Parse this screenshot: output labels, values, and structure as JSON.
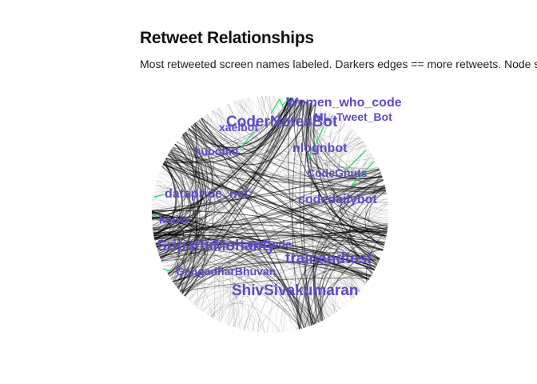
{
  "title": "Retweet Relationships",
  "subtitle": "Most retweeted screen names labeled. Darkers edges == more retweets. Node s",
  "colors": {
    "label": "#5b4bc4",
    "highlight_edge": "#22e06a",
    "edge": "#000000"
  },
  "nodes": [
    {
      "id": "women_who_code",
      "label": "Women_who_code",
      "size": "medium"
    },
    {
      "id": "ml_tweet_bot",
      "label": "ML_Tweet_Bot",
      "size": "small"
    },
    {
      "id": "codernotesbot",
      "label": "CoderNotesBot",
      "size": "large"
    },
    {
      "id": "xaelbot",
      "label": "xaelbot",
      "size": "small"
    },
    {
      "id": "hubofml",
      "label": "hubofml",
      "size": "small"
    },
    {
      "id": "nlognbot",
      "label": "nlognbot",
      "size": "medium"
    },
    {
      "id": "codegnuts",
      "label": "CodeGnuts",
      "size": "small"
    },
    {
      "id": "datapride_net",
      "label": "datapride_net",
      "size": "medium"
    },
    {
      "id": "codedailybot",
      "label": "codedailybot",
      "size": "medium"
    },
    {
      "id": "koder",
      "label": "koder",
      "size": "small"
    },
    {
      "id": "leetcode",
      "label": "LeetCode",
      "size": "small"
    },
    {
      "id": "sripathimohanty",
      "label": "SripathiMohanty",
      "size": "large"
    },
    {
      "id": "trainandtest",
      "label": "trainandtest",
      "size": "large"
    },
    {
      "id": "gangadharbhuvan",
      "label": "GangadharBhuvan",
      "size": "small"
    },
    {
      "id": "shivsivakumaran",
      "label": "ShivSivakumaran",
      "size": "large"
    }
  ]
}
